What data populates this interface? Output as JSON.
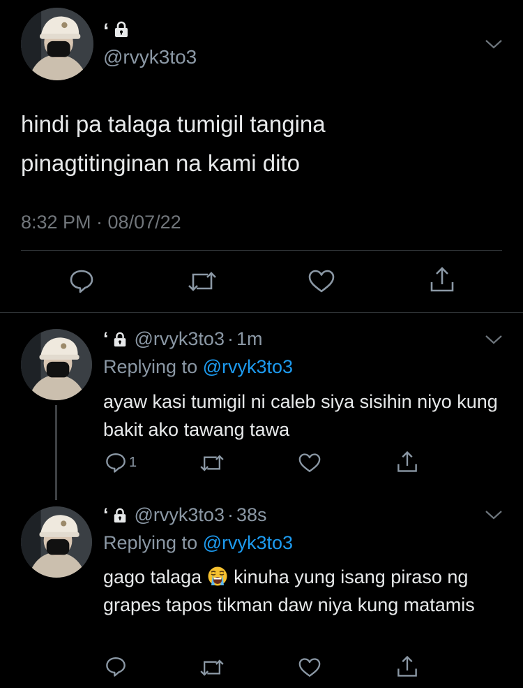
{
  "main_tweet": {
    "display_name": "ʻ",
    "handle": "@rvyk3to3",
    "text": "hindi pa talaga tumigil tangina\npinagtitinginan na kami dito",
    "timestamp": "8:32 PM · 08/07/22",
    "actions": [
      "reply-icon",
      "retweet-icon",
      "like-icon",
      "share-icon"
    ]
  },
  "replies": [
    {
      "display_name": "ʻ",
      "handle": "@rvyk3to3",
      "separator": "·",
      "time": "1m",
      "replying_prefix": "Replying to",
      "replying_handle": "@rvyk3to3",
      "text": "ayaw kasi tumigil ni caleb siya sisihin niyo kung bakit ako tawang tawa",
      "reply_count": "1"
    },
    {
      "display_name": "ʻ",
      "handle": "@rvyk3to3",
      "separator": "·",
      "time": "38s",
      "replying_prefix": "Replying to",
      "replying_handle": "@rvyk3to3",
      "text_before_emoji": "gago talaga",
      "emoji": "loudly-crying-face-emoji",
      "text_after_emoji": "kinuha yung isang piraso ng grapes tapos tikman daw niya kung matamis"
    }
  ],
  "colors": {
    "background": "#000000",
    "text_primary": "#e7e9ea",
    "text_secondary": "#8b98a5",
    "link": "#1d9bf0",
    "divider": "#2f3336"
  }
}
